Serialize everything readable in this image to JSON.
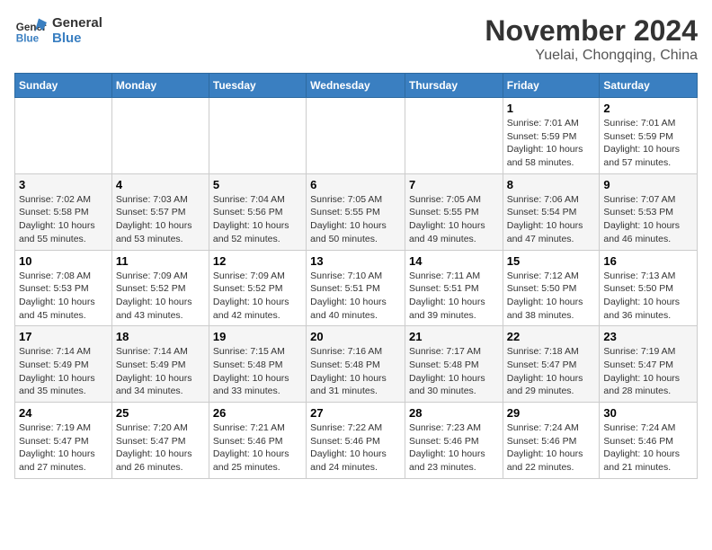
{
  "header": {
    "logo_line1": "General",
    "logo_line2": "Blue",
    "month_year": "November 2024",
    "location": "Yuelai, Chongqing, China"
  },
  "weekdays": [
    "Sunday",
    "Monday",
    "Tuesday",
    "Wednesday",
    "Thursday",
    "Friday",
    "Saturday"
  ],
  "weeks": [
    [
      {
        "day": "",
        "info": ""
      },
      {
        "day": "",
        "info": ""
      },
      {
        "day": "",
        "info": ""
      },
      {
        "day": "",
        "info": ""
      },
      {
        "day": "",
        "info": ""
      },
      {
        "day": "1",
        "info": "Sunrise: 7:01 AM\nSunset: 5:59 PM\nDaylight: 10 hours and 58 minutes."
      },
      {
        "day": "2",
        "info": "Sunrise: 7:01 AM\nSunset: 5:59 PM\nDaylight: 10 hours and 57 minutes."
      }
    ],
    [
      {
        "day": "3",
        "info": "Sunrise: 7:02 AM\nSunset: 5:58 PM\nDaylight: 10 hours and 55 minutes."
      },
      {
        "day": "4",
        "info": "Sunrise: 7:03 AM\nSunset: 5:57 PM\nDaylight: 10 hours and 53 minutes."
      },
      {
        "day": "5",
        "info": "Sunrise: 7:04 AM\nSunset: 5:56 PM\nDaylight: 10 hours and 52 minutes."
      },
      {
        "day": "6",
        "info": "Sunrise: 7:05 AM\nSunset: 5:55 PM\nDaylight: 10 hours and 50 minutes."
      },
      {
        "day": "7",
        "info": "Sunrise: 7:05 AM\nSunset: 5:55 PM\nDaylight: 10 hours and 49 minutes."
      },
      {
        "day": "8",
        "info": "Sunrise: 7:06 AM\nSunset: 5:54 PM\nDaylight: 10 hours and 47 minutes."
      },
      {
        "day": "9",
        "info": "Sunrise: 7:07 AM\nSunset: 5:53 PM\nDaylight: 10 hours and 46 minutes."
      }
    ],
    [
      {
        "day": "10",
        "info": "Sunrise: 7:08 AM\nSunset: 5:53 PM\nDaylight: 10 hours and 45 minutes."
      },
      {
        "day": "11",
        "info": "Sunrise: 7:09 AM\nSunset: 5:52 PM\nDaylight: 10 hours and 43 minutes."
      },
      {
        "day": "12",
        "info": "Sunrise: 7:09 AM\nSunset: 5:52 PM\nDaylight: 10 hours and 42 minutes."
      },
      {
        "day": "13",
        "info": "Sunrise: 7:10 AM\nSunset: 5:51 PM\nDaylight: 10 hours and 40 minutes."
      },
      {
        "day": "14",
        "info": "Sunrise: 7:11 AM\nSunset: 5:51 PM\nDaylight: 10 hours and 39 minutes."
      },
      {
        "day": "15",
        "info": "Sunrise: 7:12 AM\nSunset: 5:50 PM\nDaylight: 10 hours and 38 minutes."
      },
      {
        "day": "16",
        "info": "Sunrise: 7:13 AM\nSunset: 5:50 PM\nDaylight: 10 hours and 36 minutes."
      }
    ],
    [
      {
        "day": "17",
        "info": "Sunrise: 7:14 AM\nSunset: 5:49 PM\nDaylight: 10 hours and 35 minutes."
      },
      {
        "day": "18",
        "info": "Sunrise: 7:14 AM\nSunset: 5:49 PM\nDaylight: 10 hours and 34 minutes."
      },
      {
        "day": "19",
        "info": "Sunrise: 7:15 AM\nSunset: 5:48 PM\nDaylight: 10 hours and 33 minutes."
      },
      {
        "day": "20",
        "info": "Sunrise: 7:16 AM\nSunset: 5:48 PM\nDaylight: 10 hours and 31 minutes."
      },
      {
        "day": "21",
        "info": "Sunrise: 7:17 AM\nSunset: 5:48 PM\nDaylight: 10 hours and 30 minutes."
      },
      {
        "day": "22",
        "info": "Sunrise: 7:18 AM\nSunset: 5:47 PM\nDaylight: 10 hours and 29 minutes."
      },
      {
        "day": "23",
        "info": "Sunrise: 7:19 AM\nSunset: 5:47 PM\nDaylight: 10 hours and 28 minutes."
      }
    ],
    [
      {
        "day": "24",
        "info": "Sunrise: 7:19 AM\nSunset: 5:47 PM\nDaylight: 10 hours and 27 minutes."
      },
      {
        "day": "25",
        "info": "Sunrise: 7:20 AM\nSunset: 5:47 PM\nDaylight: 10 hours and 26 minutes."
      },
      {
        "day": "26",
        "info": "Sunrise: 7:21 AM\nSunset: 5:46 PM\nDaylight: 10 hours and 25 minutes."
      },
      {
        "day": "27",
        "info": "Sunrise: 7:22 AM\nSunset: 5:46 PM\nDaylight: 10 hours and 24 minutes."
      },
      {
        "day": "28",
        "info": "Sunrise: 7:23 AM\nSunset: 5:46 PM\nDaylight: 10 hours and 23 minutes."
      },
      {
        "day": "29",
        "info": "Sunrise: 7:24 AM\nSunset: 5:46 PM\nDaylight: 10 hours and 22 minutes."
      },
      {
        "day": "30",
        "info": "Sunrise: 7:24 AM\nSunset: 5:46 PM\nDaylight: 10 hours and 21 minutes."
      }
    ]
  ]
}
